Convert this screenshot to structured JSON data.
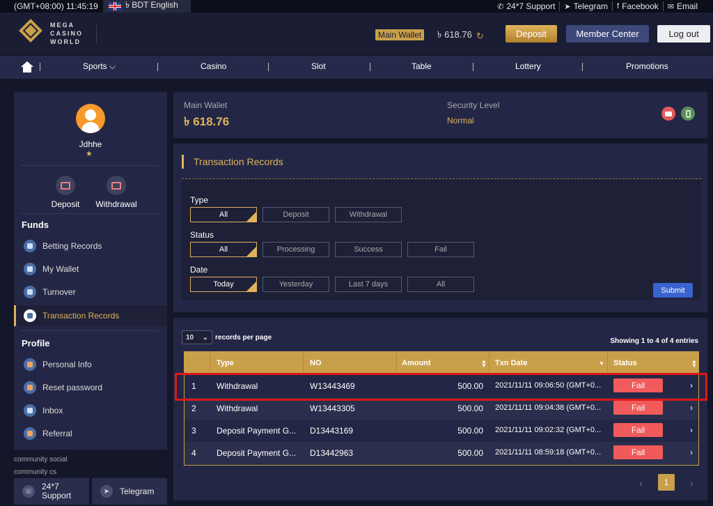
{
  "topbar": {
    "time": "(GMT+08:00) 11:45:19",
    "language": "৳ BDT English",
    "links": [
      {
        "label": "24*7 Support",
        "icon": "phone-icon"
      },
      {
        "label": "Telegram",
        "icon": "telegram-icon"
      },
      {
        "label": "Facebook",
        "icon": "facebook-icon"
      },
      {
        "label": "Email",
        "icon": "email-icon"
      }
    ]
  },
  "header": {
    "logo_text": [
      "MEGA",
      "CASINO",
      "WORLD"
    ],
    "wallet_badge": "Main Wallet",
    "wallet_amount": "৳  618.76",
    "deposit": "Deposit",
    "member_center": "Member Center",
    "logout": "Log out"
  },
  "nav": {
    "items": [
      "Sports",
      "Casino",
      "Slot",
      "Table",
      "Lottery",
      "Promotions"
    ],
    "dropdown_arrow": "⌄"
  },
  "sidebar": {
    "username": "Jdhhe",
    "star": "★",
    "quick_actions": [
      "Deposit",
      "Withdrawal"
    ],
    "funds_title": "Funds",
    "funds_items": [
      "Betting Records",
      "My Wallet",
      "Turnover",
      "Transaction Records"
    ],
    "profile_title": "Profile",
    "profile_items": [
      "Personal Info",
      "Reset password",
      "Inbox",
      "Referral"
    ],
    "community_social": "community social",
    "community_cs": "community cs",
    "support_label": "24*7\nSupport",
    "telegram_label": "Telegram"
  },
  "wallet_panel": {
    "label": "Main Wallet",
    "value": "৳ 618.76",
    "security_label": "Security Level",
    "security_value": "Normal"
  },
  "transactions": {
    "title": "Transaction Records",
    "type_label": "Type",
    "type_options": [
      "All",
      "Deposit",
      "Withdrawal"
    ],
    "status_label": "Status",
    "status_options": [
      "All",
      "Processing",
      "Success",
      "Fail"
    ],
    "date_label": "Date",
    "date_options": [
      "Today",
      "Yesterday",
      "Last 7 days",
      "All"
    ],
    "submit": "Submit"
  },
  "records": {
    "per_page": "10",
    "per_page_label": "records per page",
    "showing": "Showing 1 to 4 of 4 entries",
    "columns": [
      "Type",
      "NO",
      "Amount",
      "Txn Date",
      "Status"
    ],
    "rows": [
      {
        "idx": "1",
        "type": "Withdrawal",
        "no": "W13443469",
        "amount": "500.00",
        "date": "2021/11/11 09:06:50 (GMT+0...",
        "status": "Fail"
      },
      {
        "idx": "2",
        "type": "Withdrawal",
        "no": "W13443305",
        "amount": "500.00",
        "date": "2021/11/11 09:04:38 (GMT+0...",
        "status": "Fail"
      },
      {
        "idx": "3",
        "type": "Deposit Payment G...",
        "no": "D13443169",
        "amount": "500.00",
        "date": "2021/11/11 09:02:32 (GMT+0...",
        "status": "Fail"
      },
      {
        "idx": "4",
        "type": "Deposit Payment G...",
        "no": "D13442963",
        "amount": "500.00",
        "date": "2021/11/11 08:59:18 (GMT+0...",
        "status": "Fail"
      }
    ],
    "page": "1",
    "prev": "‹",
    "next": "›"
  }
}
